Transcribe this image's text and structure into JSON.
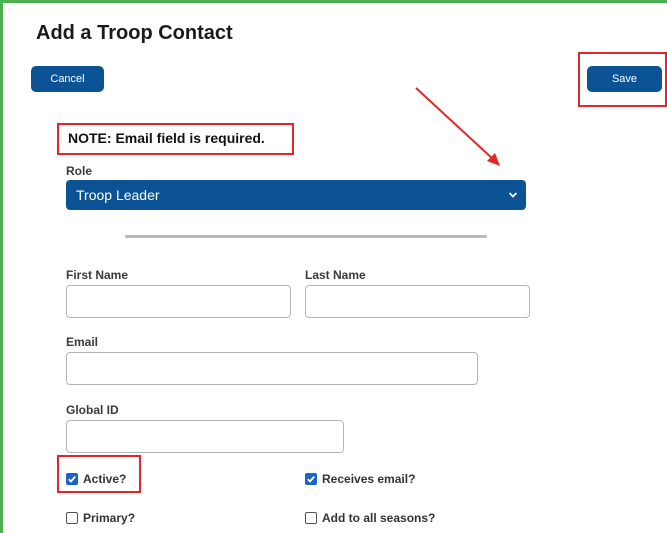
{
  "page": {
    "title": "Add a Troop Contact"
  },
  "toolbar": {
    "cancel_label": "Cancel",
    "save_label": "Save"
  },
  "note": "NOTE: Email field is required.",
  "role": {
    "label": "Role",
    "selected": "Troop Leader"
  },
  "fields": {
    "first_name": {
      "label": "First Name",
      "value": ""
    },
    "last_name": {
      "label": "Last Name",
      "value": ""
    },
    "email": {
      "label": "Email",
      "value": ""
    },
    "global_id": {
      "label": "Global ID",
      "value": ""
    }
  },
  "checkboxes": {
    "active": {
      "label": "Active?",
      "checked": true
    },
    "receives_email": {
      "label": "Receives email?",
      "checked": true
    },
    "primary": {
      "label": "Primary?",
      "checked": false
    },
    "add_to_all_seasons": {
      "label": "Add to all seasons?",
      "checked": false
    }
  },
  "colors": {
    "accent": "#0b5394",
    "highlight": "#e02828",
    "frame": "#4caf50",
    "checkbox": "#1e63c6"
  }
}
